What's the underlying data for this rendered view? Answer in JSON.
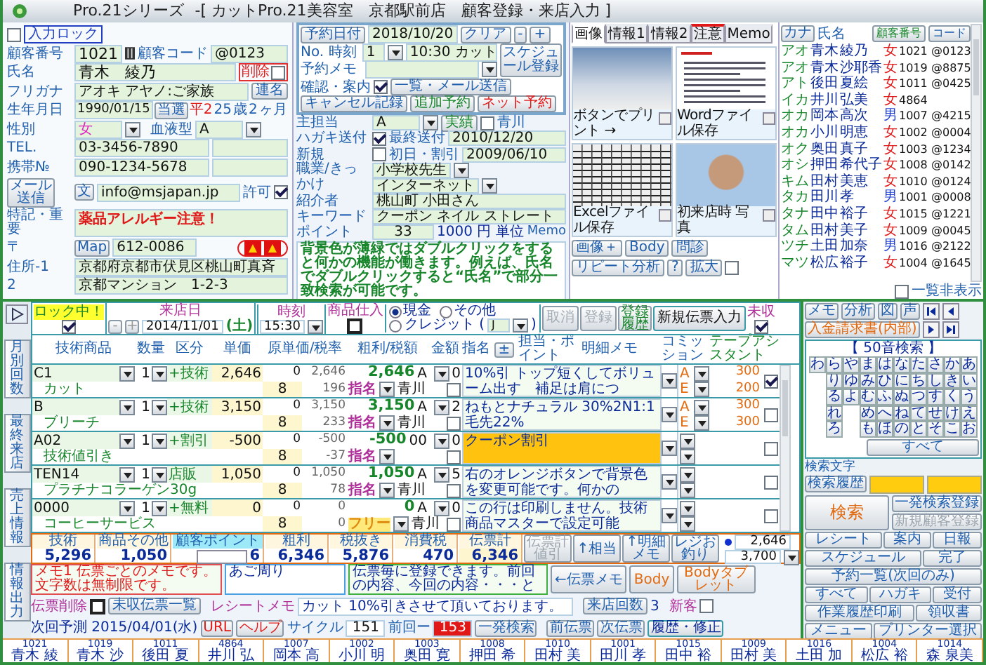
{
  "window": {
    "app": "Pro.21シリーズ",
    "title": "-[ カットPro.21美容室　京都駅前店　顧客登録・来店入力 ]"
  },
  "customer": {
    "input_lock": {
      "label": "入力ロック",
      "checked": false
    },
    "number": {
      "label": "顧客番号",
      "value": "1021",
      "code_label": "顧客コード",
      "code": "@0123"
    },
    "name": {
      "label": "氏名",
      "value": "青木　綾乃",
      "delete_label": "削除",
      "delete_checked": false
    },
    "kana": {
      "label": "フリガナ",
      "value": "アオキ アヤノ:ご家族",
      "button": "連名"
    },
    "birthday": {
      "label": "生年月日",
      "value": "1990/01/15",
      "button": "当選",
      "era": "平2",
      "age": "25",
      "age_unit": "歳",
      "months": "2",
      "months_unit": "ヶ月"
    },
    "gender": {
      "label": "性別",
      "value": "女"
    },
    "blood": {
      "label": "血液型",
      "value": "A"
    },
    "tel": {
      "label": "TEL.",
      "value": "03-3456-7890"
    },
    "mobile": {
      "label": "携帯№",
      "value": "090-1234-5678"
    },
    "mail": {
      "send_button": "メール送信",
      "text_button": "文",
      "value": "info@msjapan.jp",
      "permit_label": "許可",
      "permit_checked": true
    },
    "note": {
      "label": "特記・重要",
      "value": "薬品アレルギー注意！"
    },
    "zip": {
      "label": "〒",
      "button": "Map",
      "value": "612-0086"
    },
    "address1": {
      "label": "住所-1",
      "value": "京都府京都市伏見区桃山町真斉"
    },
    "address2": {
      "label": "2",
      "value": "京都マンション　1-2-3"
    }
  },
  "reservation": {
    "date_button": "予約日付",
    "date": "2018/10/20",
    "clear_button": "クリア",
    "minus_button": "-",
    "plus_button": "+",
    "schedule_button": "スケジュール登録",
    "no_label": "No. 時刻",
    "no": "1",
    "time": "10:30 カット",
    "memo_label": "予約メモ",
    "confirm_label": "確認・案内",
    "confirm_checked": true,
    "mail_button": "一覧・メール送信",
    "cancel_button": "キャンセル記録",
    "add_button": "追加予約",
    "net_button": "ネット予約"
  },
  "profile": {
    "staff": {
      "label": "主担当",
      "value": "A",
      "button": "実績",
      "option_label": "青川",
      "option_checked": false
    },
    "postcard": {
      "label": "ハガキ送付",
      "checked": true,
      "last_label": "最終送付",
      "last": "2010/12/20"
    },
    "new": {
      "label": "新規",
      "checked": false,
      "first_label": "初日・割引",
      "first": "2009/06/10"
    },
    "job": {
      "label": "職業/きっかけ",
      "value": "小学校先生",
      "trigger": "インターネット"
    },
    "referrer": {
      "label": "紹介者",
      "value": "桃山町 小田さん"
    },
    "keyword": {
      "label": "キーワード",
      "value": "クーポン ネイル ストレート"
    },
    "points": {
      "label": "ポイント",
      "value": "33",
      "unit": "1000 円 単位"
    },
    "memo": {
      "label": "Memo",
      "value": "背景色が薄緑ではダブルクリックをすると何かの機能が働きます。例えば、氏名でダブルクリックすると“氏名”で部分一致検索が可能です。"
    }
  },
  "media": {
    "tabs": [
      {
        "label": "画像",
        "selected": true,
        "alert": false
      },
      {
        "label": "情報1",
        "selected": false,
        "alert": false
      },
      {
        "label": "情報2",
        "selected": false,
        "alert": false
      },
      {
        "label": "注意",
        "selected": false,
        "alert": true
      },
      {
        "label": "Memo",
        "selected": false,
        "alert": false
      }
    ],
    "tiles": [
      {
        "kind": "photo",
        "caption": "ボタンでプリント →"
      },
      {
        "kind": "document",
        "caption": "Wordファイル保存"
      },
      {
        "kind": "spreadsheet",
        "caption": "Excelファイル保存"
      },
      {
        "kind": "portrait",
        "caption": "初来店時 写真"
      }
    ],
    "buttons": [
      "画像＋",
      "Body",
      "問診",
      "リピート分析",
      "?",
      "拡大"
    ],
    "option_checked": false
  },
  "customer_list": {
    "kana_button": "カナ",
    "name_label": "氏名",
    "number_button": "顧客番号",
    "code_button": "コード",
    "rows": [
      {
        "kana": "アオ",
        "surname": "青木",
        "given": "綾乃",
        "gender": "女",
        "male": false,
        "number": "1021",
        "code": "@0123"
      },
      {
        "kana": "アオ",
        "surname": "青木",
        "given": "沙耶香",
        "gender": "女",
        "male": false,
        "number": "1019",
        "code": "@8875"
      },
      {
        "kana": "アト",
        "surname": "後田",
        "given": "夏絵",
        "gender": "女",
        "male": false,
        "number": "1011",
        "code": "@0425"
      },
      {
        "kana": "イカ",
        "surname": "井川",
        "given": "弘美",
        "gender": "女",
        "male": false,
        "number": "4864"
      },
      {
        "kana": "オカ",
        "surname": "岡本",
        "given": "高次",
        "gender": "男",
        "male": true,
        "number": "1007",
        "code": "@4215"
      },
      {
        "kana": "オカ",
        "surname": "小川",
        "given": "明恵",
        "gender": "女",
        "male": false,
        "number": "1002",
        "code": "@0004"
      },
      {
        "kana": "オク",
        "surname": "奥田",
        "given": "真子",
        "gender": "女",
        "male": false,
        "number": "1003",
        "code": "@1234"
      },
      {
        "kana": "オシ",
        "surname": "押田",
        "given": "希代子",
        "gender": "女",
        "male": false,
        "number": "1008",
        "code": "@0142"
      },
      {
        "kana": "キム",
        "surname": "田村",
        "given": "美恵",
        "gender": "女",
        "male": false,
        "number": "1010",
        "code": "@0124"
      },
      {
        "kana": "タカ",
        "surname": "田川",
        "given": "孝",
        "gender": "男",
        "male": true,
        "number": "1001",
        "code": "@0008"
      },
      {
        "kana": "タナ",
        "surname": "田中",
        "given": "裕子",
        "gender": "女",
        "male": false,
        "number": "1015",
        "code": "@1221"
      },
      {
        "kana": "タム",
        "surname": "田村",
        "given": "美子",
        "gender": "女",
        "male": false,
        "number": "1009",
        "code": "@0045"
      },
      {
        "kana": "ツチ",
        "surname": "土田",
        "given": "加奈",
        "gender": "男",
        "male": true,
        "number": "1016",
        "code": "@2122"
      },
      {
        "kana": "マツ",
        "surname": "松広",
        "given": "裕子",
        "gender": "女",
        "male": false,
        "number": "1004",
        "code": "@1645"
      }
    ],
    "hide_label": "一覧非表示",
    "hide_checked": false
  },
  "side_tabs": [
    "月別回数",
    "最終来店",
    "売上情報",
    "情報出力"
  ],
  "slip": {
    "lock": {
      "label": "ロック中！",
      "checked": true
    },
    "date_label": "来店日",
    "minus_button": "-",
    "plus_button": "+",
    "date": "2014/11/01",
    "weekday": "(土)",
    "time_label": "時刻",
    "time": "15:30",
    "stock_label": "商品仕入",
    "stock_checked": false,
    "payments": [
      {
        "label": "現金",
        "selected": true
      },
      {
        "label": "その他",
        "selected": false
      },
      {
        "label": "クレジット (",
        "selected": false
      }
    ],
    "card": "J",
    "card_close": ")",
    "buttons": [
      {
        "label": "取消",
        "disabled": true
      },
      {
        "label": "登録",
        "disabled": true
      },
      {
        "label": "登録履歴",
        "disabled": false
      },
      {
        "label": "新規伝票入力",
        "disabled": false
      }
    ],
    "unpaid_label": "未収",
    "unpaid_checked": true,
    "columns": [
      "技術商品",
      "数量",
      "区分",
      "単価",
      "原単価/税率",
      "粗利/税額",
      "金額",
      "指名"
    ],
    "pm_button": "±",
    "staff_label": "担当・ポイント",
    "memo_label": "明細メモ",
    "commission_label": "コミッション",
    "assistant_label": "テープアシスタント",
    "items": [
      {
        "code": "C1",
        "name": "カット",
        "qty": "1",
        "category": "+技術",
        "price": "2,646",
        "cost": "0",
        "tax_rate": "8",
        "profit": "2,646",
        "tax": "196",
        "amount": "2,646",
        "staff": "A",
        "nomination": "指名",
        "free": false,
        "nominee": "青川",
        "points": "0",
        "point_checked": false,
        "memo": "10%引 トップ短くしてボリューム出す　補足は肩につ",
        "highlight": false,
        "commissions": [
          {
            "staff": "A",
            "value": "300"
          },
          {
            "staff": "E",
            "value": "200"
          }
        ],
        "checked": true
      },
      {
        "code": "B",
        "name": "ブリーチ",
        "qty": "1",
        "category": "+技術",
        "price": "3,150",
        "cost": "0",
        "tax_rate": "8",
        "profit": "3,150",
        "tax": "233",
        "amount": "3,150",
        "staff": "A",
        "nomination": "指名",
        "free": false,
        "nominee": "青川",
        "points": "2",
        "point_checked": false,
        "memo": "ねもとナチュラル 30%2N1:1 毛先22%",
        "highlight": false,
        "commissions": [
          {
            "staff": "A",
            "value": "300"
          },
          {
            "staff": "E",
            "value": "300"
          }
        ],
        "checked": false
      },
      {
        "code": "A02",
        "name": "技術値引き",
        "qty": "1",
        "category": "+割引",
        "price": "-500",
        "cost": "0",
        "tax_rate": "8",
        "profit": "-500",
        "tax": "-37",
        "amount": "-500",
        "staff": "00",
        "nomination": "指名",
        "free": false,
        "points": "0",
        "point_checked": false,
        "memo": "クーポン割引",
        "highlight": true,
        "checked": false
      },
      {
        "code": "TEN14",
        "name": "プラチナコラーゲン30g",
        "qty": "1",
        "category": "店販",
        "price": "1,050",
        "cost": "0",
        "tax_rate": "8",
        "profit": "1,050",
        "tax": "78",
        "amount": "1,050",
        "staff": "A",
        "nomination": "指名",
        "free": false,
        "nominee": "青川",
        "points": "5",
        "point_checked": false,
        "memo": "右のオレンジボタンで背景色を変更可能です。何かの",
        "highlight": false,
        "checked": false
      },
      {
        "code": "0000",
        "name": "コーヒーサービス",
        "qty": "1",
        "category": "+無料",
        "price": "0",
        "cost": "0",
        "tax_rate": "8",
        "profit": "0",
        "tax": "0",
        "amount": "0",
        "staff": "A",
        "nomination": "フリー",
        "free": true,
        "nominee": "青川",
        "points": "0",
        "point_checked": false,
        "memo": "この行は印刷しません。技術商品マスターで設定可能",
        "highlight": false,
        "checked": false
      }
    ]
  },
  "totals": {
    "cells": [
      {
        "label": "技術",
        "value": "5,296",
        "kind": "plain"
      },
      {
        "label": "商品その他",
        "value": "1,050",
        "kind": "plain"
      },
      {
        "label": "顧客ポイント",
        "value": "6",
        "kind": "points"
      },
      {
        "label": "粗利",
        "value": "6,346",
        "kind": "plain"
      },
      {
        "label": "税抜き",
        "value": "5,876",
        "kind": "plain"
      },
      {
        "label": "消費税",
        "value": "470",
        "kind": "plain"
      },
      {
        "label": "伝票計",
        "value": "6,346",
        "kind": "total"
      }
    ],
    "buttons": [
      "伝票計値引",
      "↑相当",
      "↑明細メモ",
      "レジお釣り"
    ],
    "received": "2,646",
    "change": "3,700"
  },
  "memos": {
    "memo1": "メモ1 伝票ごとのメモです。文字数は無制限です。",
    "memo2": "あご周り",
    "memo3": "伝票毎に登録できます。前回の内容、今回の内容・・・と",
    "buttons": [
      "←伝票メモ",
      "Body",
      "Bodyタブレット"
    ]
  },
  "actions": {
    "delete_label": "伝票削除",
    "delete_checked": false,
    "unpaid_list_button": "未収伝票一覧",
    "receipt_label": "レシートメモ",
    "receipt": "カット 10%引きさせて頂いております。",
    "visits_button": "来店回数",
    "visits": "3"
  },
  "footer": {
    "next_label": "次回予測 2015/04/01(水)",
    "url_button": "URL",
    "help_button": "ヘルプ",
    "cycle_label": "サイクル",
    "cycle": "151",
    "last_label": "前回ー",
    "last": "153",
    "quick_button": "一発検索",
    "new_customer_label": "新客",
    "new_customer_checked": false,
    "prev_button": "前伝票",
    "next_button": "次伝票",
    "history_button": "履歴・修正"
  },
  "history": [
    {
      "number": "1021",
      "name": "青木 綾"
    },
    {
      "number": "1019",
      "name": "青木 沙"
    },
    {
      "number": "1011",
      "name": "後田 夏"
    },
    {
      "number": "4864",
      "name": "井川 弘"
    },
    {
      "number": "1007",
      "name": "岡本 高"
    },
    {
      "number": "1002",
      "name": "小川 明"
    },
    {
      "number": "1003",
      "name": "奥田 寛"
    },
    {
      "number": "1008",
      "name": "押田 希"
    },
    {
      "number": "1010",
      "name": "田村 美"
    },
    {
      "number": "1001",
      "name": "田川 孝"
    },
    {
      "number": "1015",
      "name": "田中 裕"
    },
    {
      "number": "1009",
      "name": "田村 美"
    },
    {
      "number": "1016",
      "name": "土田 加"
    },
    {
      "number": "1004",
      "name": "松広 裕"
    },
    {
      "number": "1014",
      "name": "森 泉美"
    }
  ],
  "search": {
    "top_buttons": [
      "メモ",
      "分析",
      "図",
      "声"
    ],
    "invoice_button": "入金請求書(内部)",
    "title": "【 50音検索 】",
    "kana_columns": [
      [
        "わ"
      ],
      [
        "ら",
        "り",
        "る",
        "れ",
        "ろ"
      ],
      [
        "や",
        "ゆ",
        "よ"
      ],
      [
        "ま",
        "み",
        "む",
        "め",
        "も"
      ],
      [
        "は",
        "ひ",
        "ふ",
        "へ",
        "ほ"
      ],
      [
        "な",
        "に",
        "ぬ",
        "ね",
        "の"
      ],
      [
        "た",
        "ち",
        "つ",
        "て",
        "と"
      ],
      [
        "さ",
        "し",
        "す",
        "せ",
        "そ"
      ],
      [
        "か",
        "き",
        "く",
        "け",
        "こ"
      ],
      [
        "あ",
        "い",
        "う",
        "え",
        "お"
      ]
    ],
    "all_button": "すべて",
    "text_label": "検索文字",
    "history_button": "検索履歴",
    "search_button": "検索",
    "register_button": "一発検索登録",
    "new_button": "新規顧客登録",
    "tools": [
      "レシート",
      "案内",
      "日報",
      "スケジュール",
      "完了",
      "予約一覧(次回のみ)",
      "すべて",
      "ハガキ",
      "受付",
      "作業履歴印刷",
      "領収書",
      "メニュー",
      "プリンター選択"
    ]
  }
}
